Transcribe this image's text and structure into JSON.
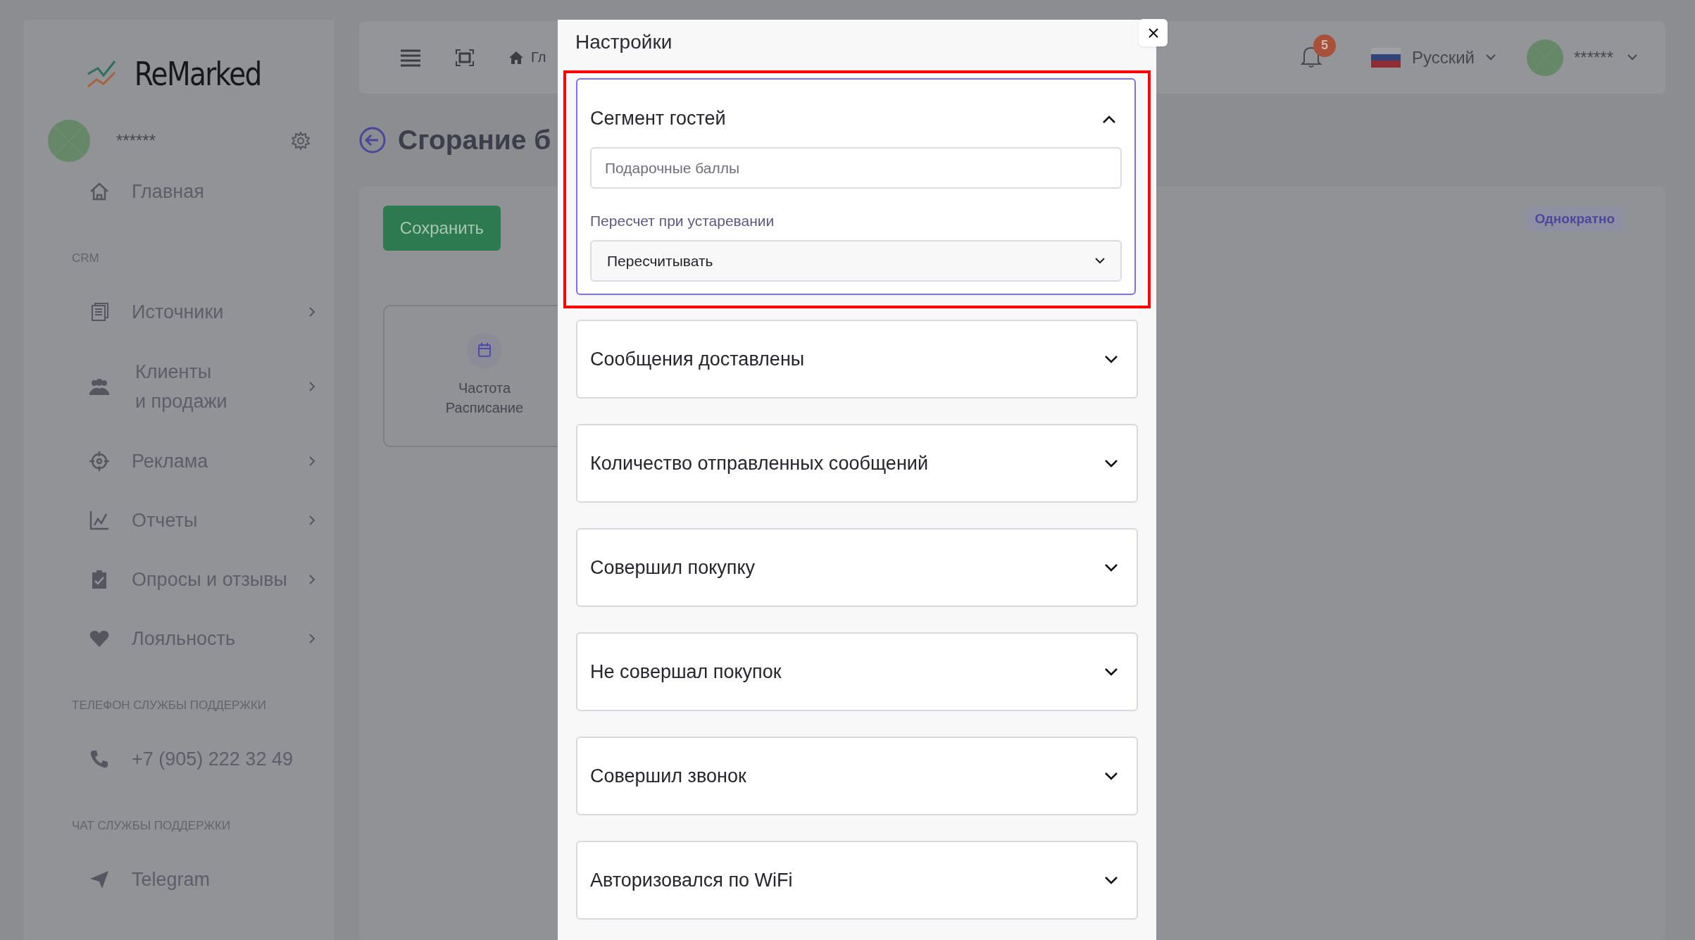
{
  "sidebar": {
    "logo": "ReMarked",
    "user": {
      "name": "******"
    },
    "items": [
      {
        "kind": "item",
        "label": "Главная",
        "expandable": false
      },
      {
        "kind": "heading",
        "label": "CRM"
      },
      {
        "kind": "item",
        "label": "Источники",
        "expandable": true
      },
      {
        "kind": "item",
        "label": "Клиенты\nи продажи",
        "expandable": true
      },
      {
        "kind": "item",
        "label": "Реклама",
        "expandable": true
      },
      {
        "kind": "item",
        "label": "Отчеты",
        "expandable": true
      },
      {
        "kind": "item",
        "label": "Опросы и отзывы",
        "expandable": true
      },
      {
        "kind": "item",
        "label": "Лояльность",
        "expandable": true
      },
      {
        "kind": "heading",
        "label": "ТЕЛЕФОН СЛУЖБЫ ПОДДЕРЖКИ"
      },
      {
        "kind": "item",
        "label": "+7 (905) 222 32 49",
        "expandable": false
      },
      {
        "kind": "heading",
        "label": "ЧАТ СЛУЖБЫ ПОДДЕРЖКИ"
      },
      {
        "kind": "item",
        "label": "Telegram",
        "expandable": false
      }
    ]
  },
  "topbar": {
    "breadcrumb": "Гл",
    "notifications": "5",
    "language": "Русский",
    "user": "******"
  },
  "page": {
    "title": "Сгорание б",
    "save_button": "Сохранить",
    "badge": "Однократно",
    "trigger_card": {
      "lines": [
        "Частота",
        "Расписание"
      ]
    }
  },
  "modal": {
    "title": "Настройки",
    "sections": [
      {
        "title": "Сегмент гостей",
        "expanded": true,
        "highlighted": true,
        "field": {
          "placeholder": "Подарочные баллы"
        },
        "select_label": "Пересчет при устаревании",
        "select_value": "Пересчитывать"
      },
      {
        "title": "Сообщения доставлены",
        "expanded": false,
        "highlighted": false
      },
      {
        "title": "Количество отправленных сообщений",
        "expanded": false,
        "highlighted": false
      },
      {
        "title": "Совершил покупку",
        "expanded": false,
        "highlighted": false
      },
      {
        "title": "Не совершал покупок",
        "expanded": false,
        "highlighted": false
      },
      {
        "title": "Совершил звонок",
        "expanded": false,
        "highlighted": false
      },
      {
        "title": "Авторизовался по WiFi",
        "expanded": false,
        "highlighted": false
      }
    ]
  }
}
